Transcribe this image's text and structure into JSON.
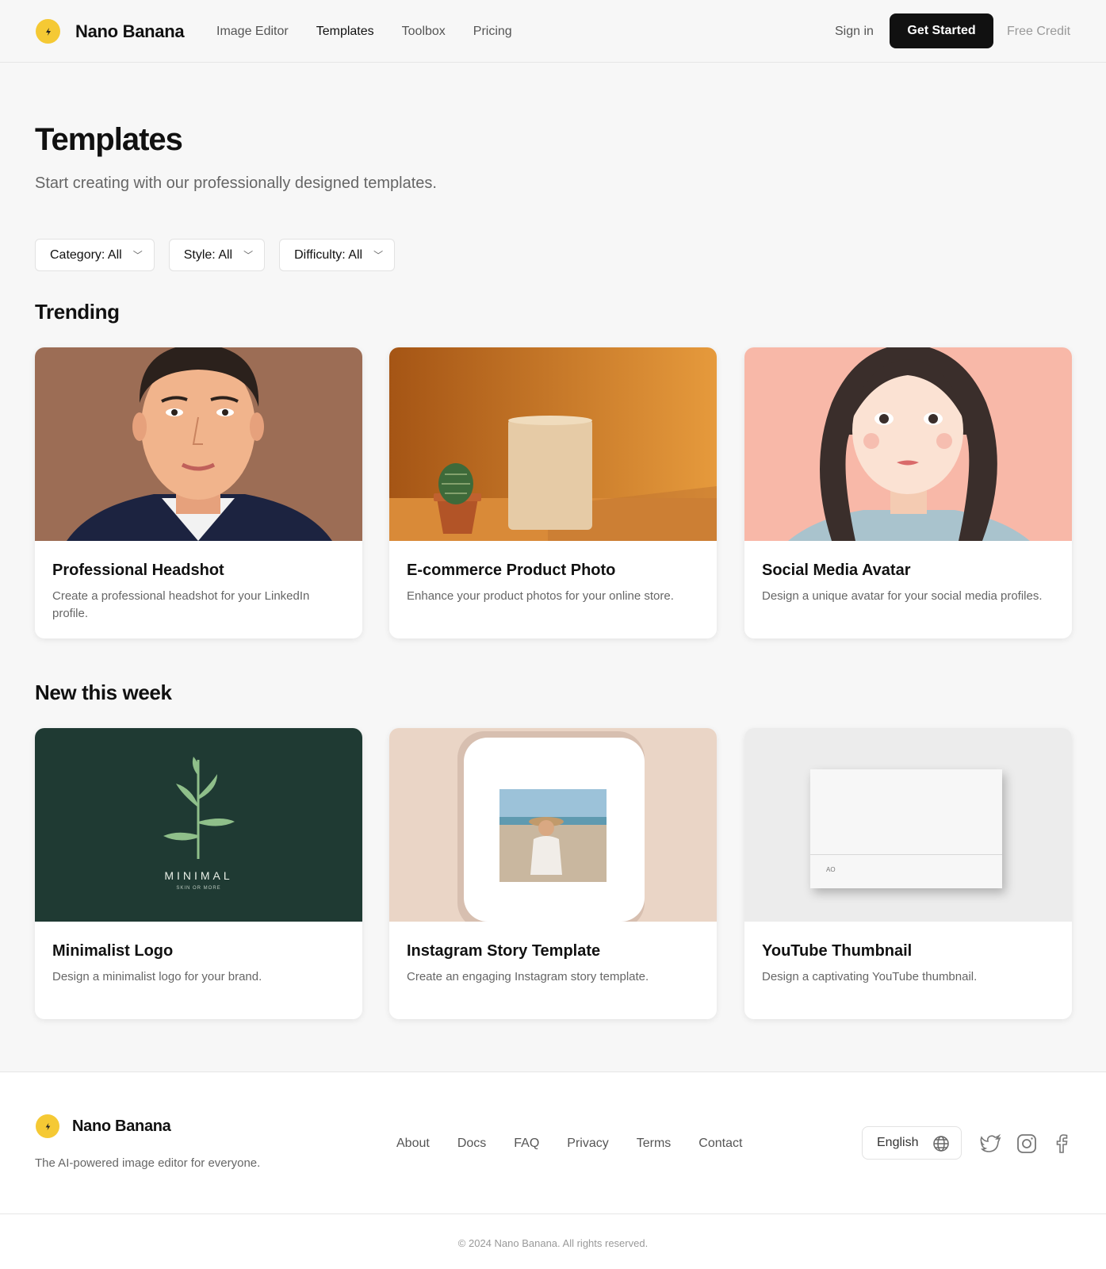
{
  "header": {
    "brand": "Nano Banana",
    "nav": [
      "Image Editor",
      "Templates",
      "Toolbox",
      "Pricing"
    ],
    "active_nav": "Templates",
    "sign_in": "Sign in",
    "cta": "Get Started",
    "free_credit": "Free Credit"
  },
  "hero": {
    "title": "Templates",
    "subtitle": "Start creating with our professionally designed templates."
  },
  "filters": [
    {
      "label": "Category: All"
    },
    {
      "label": "Style: All"
    },
    {
      "label": "Difficulty: All"
    }
  ],
  "sections": {
    "trending": {
      "title": "Trending",
      "cards": [
        {
          "title": "Professional Headshot",
          "desc": "Create a professional headshot for your LinkedIn profile."
        },
        {
          "title": "E-commerce Product Photo",
          "desc": "Enhance your product photos for your online store."
        },
        {
          "title": "Social Media Avatar",
          "desc": "Design a unique avatar for your social media profiles."
        }
      ]
    },
    "new": {
      "title": "New this week",
      "cards": [
        {
          "title": "Minimalist Logo",
          "desc": "Design a minimalist logo for your brand.",
          "logo_word": "MINIMAL",
          "logo_tagline": "SKIN OR MORE"
        },
        {
          "title": "Instagram Story Template",
          "desc": "Create an engaging Instagram story template."
        },
        {
          "title": "YouTube Thumbnail",
          "desc": "Design a captivating YouTube thumbnail.",
          "mock_label": "AO"
        }
      ]
    }
  },
  "footer": {
    "brand": "Nano Banana",
    "tagline": "The AI-powered image editor for everyone.",
    "links": [
      "About",
      "Docs",
      "FAQ",
      "Privacy",
      "Terms",
      "Contact"
    ],
    "language": "English",
    "social_icons": [
      "twitter-icon",
      "instagram-icon",
      "facebook-icon"
    ],
    "copyright": "© 2024 Nano Banana. All rights reserved."
  },
  "colors": {
    "accent": "#f5c934",
    "primary_button": "#111111",
    "background": "#f7f7f7"
  }
}
